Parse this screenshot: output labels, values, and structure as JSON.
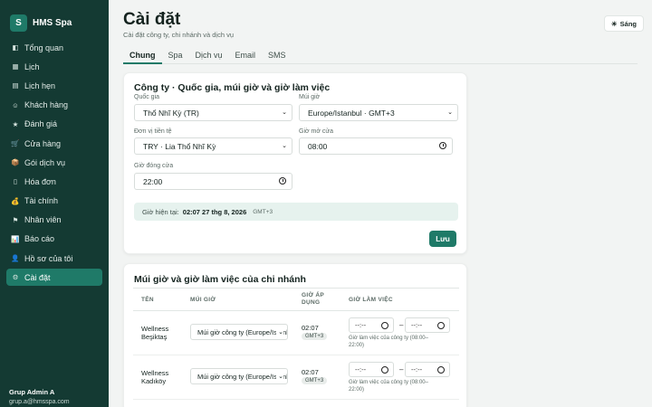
{
  "brand": {
    "logo_letter": "S",
    "name": "HMS Spa"
  },
  "nav": [
    {
      "label": "Tổng quan",
      "icon": "◧",
      "name": "dashboard"
    },
    {
      "label": "Lịch",
      "icon": "▦",
      "name": "calendar"
    },
    {
      "label": "Lịch hẹn",
      "icon": "▤",
      "name": "appointments"
    },
    {
      "label": "Khách hàng",
      "icon": "☺",
      "name": "customers"
    },
    {
      "label": "Đánh giá",
      "icon": "★",
      "name": "reviews"
    },
    {
      "label": "Cửa hàng",
      "icon": "🛒",
      "name": "store"
    },
    {
      "label": "Gói dịch vụ",
      "icon": "📦",
      "name": "packages"
    },
    {
      "label": "Hóa đơn",
      "icon": "▯",
      "name": "invoices"
    },
    {
      "label": "Tài chính",
      "icon": "💰",
      "name": "finance"
    },
    {
      "label": "Nhân viên",
      "icon": "⚑",
      "name": "staff"
    },
    {
      "label": "Báo cáo",
      "icon": "📊",
      "name": "reports"
    },
    {
      "label": "Hồ sơ của tôi",
      "icon": "👤",
      "name": "profile"
    },
    {
      "label": "Cài đặt",
      "icon": "⚙",
      "name": "settings",
      "active": true
    }
  ],
  "user": {
    "name": "Grup Admin A",
    "email": "grup.a@hmsspa.com"
  },
  "header": {
    "title": "Cài đặt",
    "subtitle": "Cài đặt công ty, chi nhánh và dịch vụ",
    "theme_icon": "☀",
    "theme_label": "Sáng"
  },
  "tabs": [
    "Chung",
    "Spa",
    "Dịch vụ",
    "Email",
    "SMS"
  ],
  "company": {
    "title": "Công ty · Quốc gia, múi giờ và giờ làm việc",
    "country_label": "Quốc gia",
    "country_value": "Thổ Nhĩ Kỳ (TR)",
    "timezone_label": "Múi giờ",
    "timezone_value": "Europe/Istanbul · GMT+3",
    "currency_label": "Đơn vị tiền tệ",
    "currency_value": "TRY · Lia Thổ Nhĩ Kỳ",
    "open_label": "Giờ mở cửa",
    "open_value": "08:00",
    "close_label": "Giờ đóng cửa",
    "close_value": "22:00",
    "now_label": "Giờ hiện tại:",
    "now_value": "02:07 27 thg 8, 2026",
    "now_tz": "GMT+3",
    "save_label": "Lưu"
  },
  "branches": {
    "title": "Múi giờ và giờ làm việc của chi nhánh",
    "headers": {
      "name": "TÊN",
      "timezone": "MÚI GIỜ",
      "applied_1": "GIỜ ÁP",
      "applied_2": "DỤNG",
      "hours": "GIỜ LÀM VIỆC"
    },
    "rows": [
      {
        "name_1": "Wellness",
        "name_2": "Beşiktaş",
        "tz": "Múi giờ công ty (Europe/Istanbul)",
        "time": "02:07",
        "badge": "GMT+3",
        "start": "--:--",
        "end": "--:--",
        "hint": "Giờ làm việc của công ty (08:00–22:00)"
      },
      {
        "name_1": "Wellness",
        "name_2": "Kadıköy",
        "tz": "Múi giờ công ty (Europe/Istanbul)",
        "time": "02:07",
        "badge": "GMT+3",
        "start": "--:--",
        "end": "--:--",
        "hint": "Giờ làm việc của công ty (08:00–22:00)"
      }
    ]
  }
}
